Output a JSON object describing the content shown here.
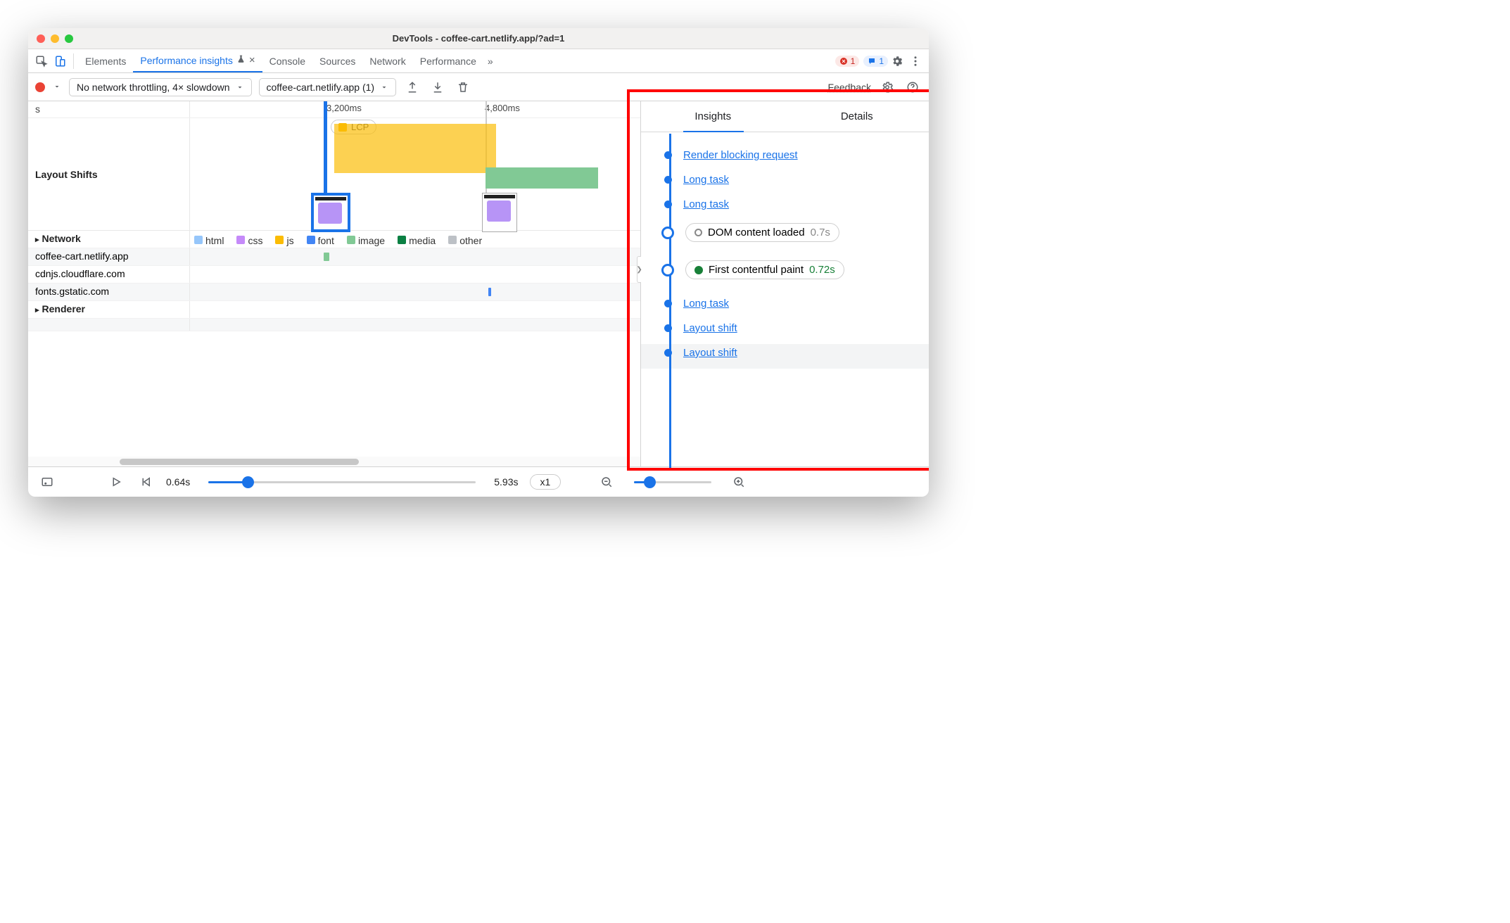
{
  "window": {
    "title": "DevTools - coffee-cart.netlify.app/?ad=1"
  },
  "tabs": {
    "items": [
      "Elements",
      "Performance insights",
      "Console",
      "Sources",
      "Network",
      "Performance"
    ],
    "more": "»",
    "error_count": "1",
    "info_count": "1"
  },
  "toolbar": {
    "throttle": "No network throttling, 4× slowdown",
    "origin": "coffee-cart.netlify.app (1)",
    "feedback": "Feedback"
  },
  "timeline": {
    "ticks": [
      "s",
      "3,200ms",
      "4,800ms"
    ],
    "lcp_label": "LCP",
    "sections": {
      "layout_shifts": "Layout Shifts",
      "network": "Network",
      "renderer": "Renderer"
    },
    "legend": [
      {
        "label": "html",
        "color": "#96c6fa"
      },
      {
        "label": "css",
        "color": "#c58af9"
      },
      {
        "label": "js",
        "color": "#fbbc04"
      },
      {
        "label": "font",
        "color": "#4285f4"
      },
      {
        "label": "image",
        "color": "#81c995"
      },
      {
        "label": "media",
        "color": "#0b8043"
      },
      {
        "label": "other",
        "color": "#bdc1c6"
      }
    ],
    "network_rows": [
      "coffee-cart.netlify.app",
      "cdnjs.cloudflare.com",
      "fonts.gstatic.com"
    ]
  },
  "right": {
    "tabs": [
      "Insights",
      "Details"
    ],
    "items": [
      {
        "type": "link",
        "label": "Render blocking request"
      },
      {
        "type": "link",
        "label": "Long task"
      },
      {
        "type": "link",
        "label": "Long task"
      },
      {
        "type": "milestone",
        "label": "DOM content loaded",
        "time": "0.7s",
        "color": "gray"
      },
      {
        "type": "milestone",
        "label": "First contentful paint",
        "time": "0.72s",
        "color": "green"
      },
      {
        "type": "link",
        "label": "Long task"
      },
      {
        "type": "link",
        "label": "Layout shift"
      },
      {
        "type": "link",
        "label": "Layout shift",
        "alt": true
      }
    ]
  },
  "footer": {
    "start": "0.64s",
    "end": "5.93s",
    "speed": "x1"
  }
}
